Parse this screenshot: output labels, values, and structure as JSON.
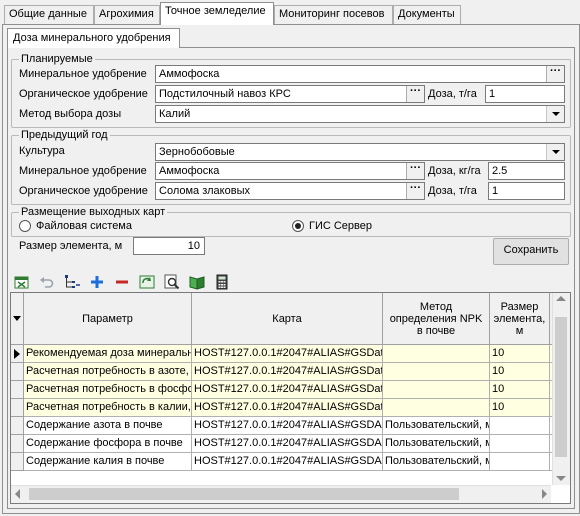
{
  "tabs": [
    "Общие данные",
    "Агрохимия",
    "Точное земледелие",
    "Мониторинг посевов",
    "Документы"
  ],
  "subtab": "Доза минерального удобрения",
  "planned": {
    "legend": "Планируемые",
    "mineral_label": "Минеральное удобрение",
    "mineral_value": "Аммофоска",
    "organic_label": "Органическое удобрение",
    "organic_value": "Подстилочный навоз КРС",
    "dose_label": "Доза, т/га",
    "dose_value": "1",
    "method_label": "Метод выбора дозы",
    "method_value": "Калий"
  },
  "previous": {
    "legend": "Предыдущий год",
    "crop_label": "Культура",
    "crop_value": "Зернобобовые",
    "mineral_label": "Минеральное удобрение",
    "mineral_value": "Аммофоска",
    "mineral_dose_label": "Доза, кг/га",
    "mineral_dose_value": "2.5",
    "organic_label": "Органическое удобрение",
    "organic_value": "Солома злаковых",
    "organic_dose_label": "Доза, т/га",
    "organic_dose_value": "1"
  },
  "placement": {
    "legend": "Размещение выходных карт",
    "option_file": "Файловая система",
    "option_gis": "ГИС Сервер",
    "selected": "ГИС Сервер"
  },
  "element_size_label": "Размер элемента, м",
  "element_size_value": "10",
  "save_button": "Сохранить",
  "ellipsis": "···",
  "toolbar_icons": [
    "excel-icon",
    "undo-icon",
    "tree-icon",
    "add-icon",
    "remove-icon",
    "refresh-icon",
    "preview-icon",
    "book-icon",
    "calculator-icon"
  ],
  "grid": {
    "columns": [
      "Параметр",
      "Карта",
      "Метод определения NPK в почве",
      "Размер элемента, м"
    ],
    "rows": [
      {
        "param": "Рекомендуемая доза минеральн",
        "map": "HOST#127.0.0.1#2047#ALIAS#GSDat",
        "method": "",
        "size": "10",
        "highlight": true,
        "current": true
      },
      {
        "param": "Расчетная потребность в азоте,",
        "map": "HOST#127.0.0.1#2047#ALIAS#GSDat",
        "method": "",
        "size": "10",
        "highlight": true,
        "current": false
      },
      {
        "param": "Расчетная потребность в фосфо",
        "map": "HOST#127.0.0.1#2047#ALIAS#GSDat",
        "method": "",
        "size": "10",
        "highlight": true,
        "current": false
      },
      {
        "param": "Расчетная потребность в калии,",
        "map": "HOST#127.0.0.1#2047#ALIAS#GSDat",
        "method": "",
        "size": "10",
        "highlight": true,
        "current": false
      },
      {
        "param": "Содержание азота в почве",
        "map": "HOST#127.0.0.1#2047#ALIAS#GSDA1",
        "method": "Пользовательский, м",
        "size": "",
        "highlight": false,
        "current": false
      },
      {
        "param": "Содержание фосфора в почве",
        "map": "HOST#127.0.0.1#2047#ALIAS#GSDA1",
        "method": "Пользовательский, м",
        "size": "",
        "highlight": false,
        "current": false
      },
      {
        "param": "Содержание калия в почве",
        "map": "HOST#127.0.0.1#2047#ALIAS#GSDA1",
        "method": "Пользовательский, м",
        "size": "",
        "highlight": false,
        "current": false
      }
    ],
    "highlight_color": "#ffffe1"
  }
}
